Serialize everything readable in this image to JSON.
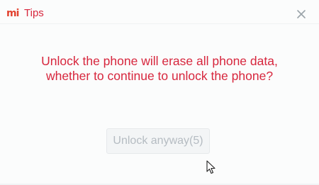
{
  "window": {
    "logo_text": "mi",
    "title": "Tips",
    "close_icon": "close-icon"
  },
  "dialog": {
    "message": "Unlock the phone will erase all phone data, whether to continue to unlock the phone?",
    "unlock_button_label": "Unlock anyway(5)",
    "unlock_button_enabled": false
  },
  "colors": {
    "accent_red": "#d7263d",
    "logo_orange": "#e2422f",
    "disabled_text": "#b5bcc2"
  }
}
